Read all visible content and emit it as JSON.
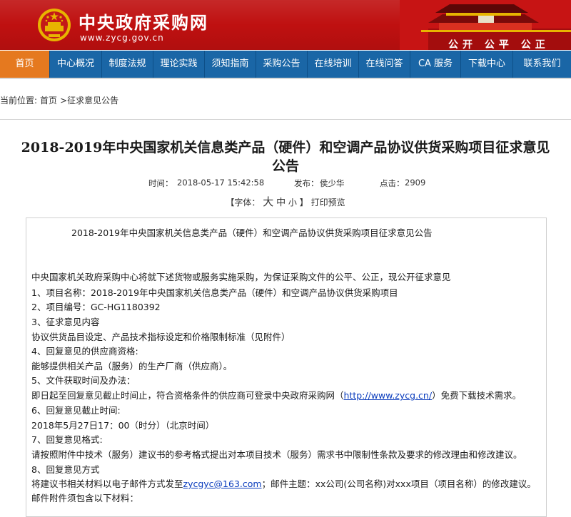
{
  "header": {
    "site_title": "中央政府采购网",
    "site_url": "www.zycg.gov.cn",
    "slogan": "公开 公平 公正"
  },
  "nav": {
    "items": [
      {
        "label": "首页",
        "active": true
      },
      {
        "label": "中心概况"
      },
      {
        "label": "制度法规"
      },
      {
        "label": "理论实践"
      },
      {
        "label": "须知指南"
      },
      {
        "label": "采购公告"
      },
      {
        "label": "在线培训"
      },
      {
        "label": "在线问答"
      },
      {
        "label": "CA 服务"
      },
      {
        "label": "下载中心"
      },
      {
        "label": "联系我们"
      }
    ]
  },
  "breadcrumb": {
    "prefix": "当前位置:",
    "home": "首页",
    "sep": ">",
    "current": "征求意见公告"
  },
  "article": {
    "title_line1": "2018-2019年中央国家机关信息类产品（硬件）和空调产品协议供货采购项目征求意见",
    "title_line2": "公告",
    "time_label": "时间：",
    "time_value": "2018-05-17 15:42:58",
    "publisher_label": "发布：",
    "publisher_value": "侯少华",
    "clicks_label": "点击：",
    "clicks_value": "2909",
    "font_label": "【字体：",
    "font_big": "大",
    "font_mid": "中",
    "font_small": "小",
    "font_close": "】",
    "print_label": "打印预览",
    "box_title": "2018-2019年中央国家机关信息类产品（硬件）和空调产品协议供货采购项目征求意见公告",
    "paragraphs": [
      "中央国家机关政府采购中心将就下述货物或服务实施采购，为保证采购文件的公平、公正，现公开征求意见",
      "1、项目名称：2018-2019年中央国家机关信息类产品（硬件）和空调产品协议供货采购项目",
      "2、项目编号：GC-HG1180392",
      "3、征求意见内容",
      "协议供货品目设定、产品技术指标设定和价格限制标准（见附件）",
      "4、回复意见的供应商资格:",
      "能够提供相关产品（服务）的生产厂商（供应商）。",
      "5、文件获取时间及办法：",
      "6、回复意见截止时间:",
      "2018年5月27日17：00（时分）（北京时间）",
      "7、回复意见格式:",
      "请按照附件中技术（服务）建议书的参考格式提出对本项目技术（服务）需求书中限制性条款及要求的修改理由和修改建议。",
      "8、回复意见方式",
      "邮件附件须包含以下材料："
    ],
    "download_pre": "即日起至回复意见截止时间止，符合资格条件的供应商可登录中央政府采购网（",
    "download_link": "http://www.zycg.cn/",
    "download_post": "）免费下载技术需求。",
    "email_pre": "将建议书相关材料以电子邮件方式发至",
    "email_link": "zycgyc@163.com",
    "email_post": "；邮件主题：xx公司(公司名称)对xxx项目（项目名称）的修改建议。"
  }
}
